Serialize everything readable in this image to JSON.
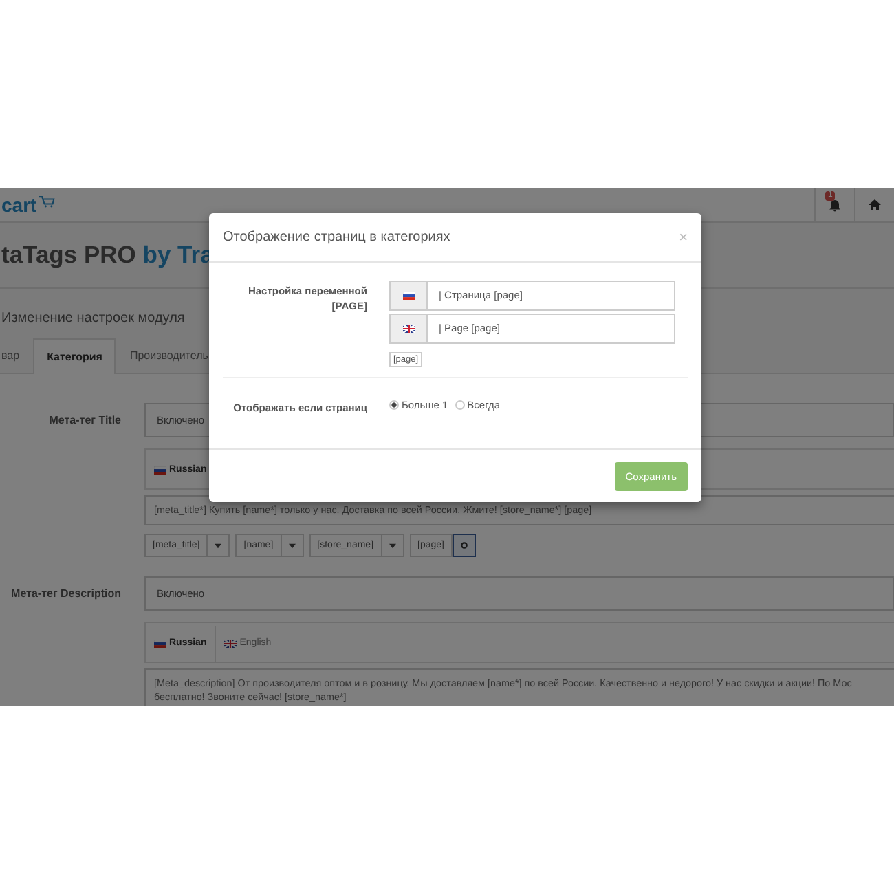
{
  "header": {
    "logo": "cart",
    "notification_badge": "1"
  },
  "page": {
    "title": "taTags PRO",
    "title_accent": "by Tra",
    "subtitle": "Изменение настроек модуля",
    "tabs": [
      {
        "label": "вар",
        "selected": false
      },
      {
        "label": "Категория",
        "selected": true
      },
      {
        "label": "Производитель",
        "selected": false
      }
    ],
    "fields": [
      {
        "label": "Мета-тег Title",
        "status": "Включено",
        "languages": [
          {
            "label": "Russian",
            "kind": "russia",
            "selected": true
          }
        ],
        "text_lines": [
          "[meta_title*] Купить [name*] только у нас. Доставка по всей России. Жмите! [store_name*] [page]"
        ],
        "variables": [
          {
            "label": "[meta_title]",
            "kind": "dropdown"
          },
          {
            "label": "[name]",
            "kind": "dropdown"
          },
          {
            "label": "[store_name]",
            "kind": "dropdown"
          },
          {
            "label": "[page]",
            "kind": "settings"
          }
        ]
      },
      {
        "label": "Мета-тег Description",
        "status": "Включено",
        "languages": [
          {
            "label": "Russian",
            "kind": "russia",
            "selected": true
          },
          {
            "label": "English",
            "kind": "uk",
            "selected": false
          }
        ],
        "text_lines": [
          "[Meta_description] От производителя оптом и в розницу. Мы доставляем [name*] по всей России. Качественно и недорого! У нас скидки и акции! По Мос",
          "бесплатно! Звоните сейчас! [store_name*]"
        ]
      }
    ]
  },
  "modal": {
    "title": "Отображение страниц в категориях",
    "close": "×",
    "variable_label": "Настройка переменной [PAGE]",
    "variable_values": [
      {
        "kind": "russia",
        "value": "| Страница [page]"
      },
      {
        "kind": "uk",
        "value": "| Page [page]"
      }
    ],
    "variable_tag": "[page]",
    "display_label": "Отображать если страниц",
    "display_options": [
      {
        "label": "Больше 1",
        "selected": true
      },
      {
        "label": "Всегда",
        "selected": false
      }
    ],
    "save_button": "Сохранить"
  }
}
